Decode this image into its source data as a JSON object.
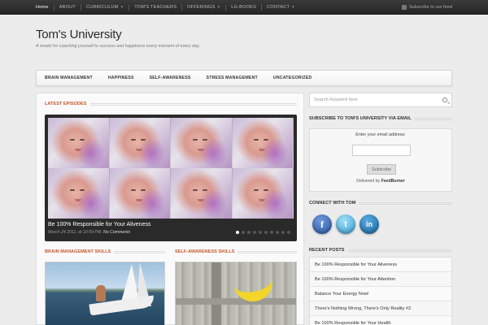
{
  "topnav": {
    "items": [
      "Home",
      "ABOUT",
      "Curriculum",
      "TOM'S TEACHERS",
      "OFFERINGS",
      "LG-BOOKS",
      "CONTACT"
    ],
    "feed_label": "Subscribe to our feed"
  },
  "site": {
    "title": "Tom's University",
    "tagline": "A model for coaching yourself to success and happiness every moment of every day."
  },
  "catnav": {
    "items": [
      "BRAIN MANAGEMENT",
      "HAPPINESS",
      "SELF-AWARENESS",
      "STRESS MANAGEMENT",
      "UNCATEGORIZED"
    ]
  },
  "main": {
    "latest_heading": "LATEST EPISODES",
    "slide": {
      "title": "Be 100% Responsible for Your Aliveness",
      "meta_date": "March 24 2011, at 10:59 PM.",
      "meta_comments": "No Comments",
      "dot_count": 10,
      "active_dot": 0
    },
    "brain_heading": "BRAIN MANAGEMENT SKILLS",
    "self_heading": "SELF-AWARENESS SKILLS"
  },
  "sidebar": {
    "search_placeholder": "Search Keyword here",
    "subscribe_heading": "SUBSCRIBE TO TOM'S UNIVERSITY VIA EMAIL",
    "email_label": "Enter your email address:",
    "subscribe_button": "Subscribe",
    "delivered_by": "Delivered by",
    "delivered_brand": "FeedBurner",
    "connect_heading": "CONNECT WITH TOM",
    "social": {
      "facebook": "f",
      "twitter": "t",
      "linkedin": "in"
    },
    "recent_heading": "RECENT POSTS",
    "recent_posts": [
      "Be 100% Responsible for Your Aliveness",
      "Be 100% Responsible for Your Attention",
      "Balance Your Energy Now!",
      "There's Nothing Wrong, There's Only Reality #2",
      "Be 100% Responsible for Your Health"
    ]
  },
  "colors": {
    "accent": "#c8572a",
    "topbar": "#2e2e2e",
    "background": "#ececec"
  }
}
